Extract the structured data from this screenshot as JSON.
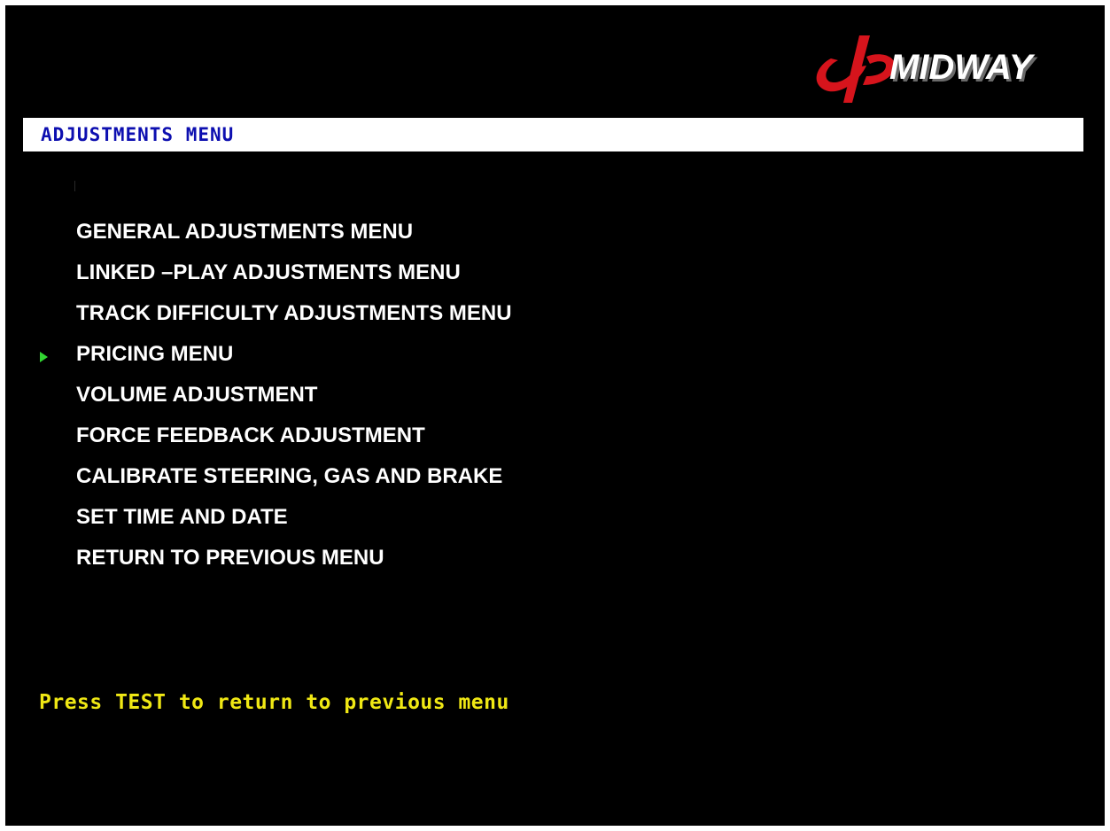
{
  "logo": {
    "text": "MIDWAY",
    "colors": {
      "emblem": "#d6141c",
      "wordmark": "#ffffff",
      "shadow": "#6a6a6a"
    }
  },
  "header": {
    "title": "ADJUSTMENTS MENU"
  },
  "menu": {
    "selected_index": 3,
    "items": [
      {
        "label": "GENERAL ADJUSTMENTS MENU"
      },
      {
        "label": "LINKED –PLAY ADJUSTMENTS MENU"
      },
      {
        "label": "TRACK DIFFICULTY ADJUSTMENTS MENU"
      },
      {
        "label": "PRICING MENU"
      },
      {
        "label": "VOLUME ADJUSTMENT"
      },
      {
        "label": "FORCE FEEDBACK ADJUSTMENT"
      },
      {
        "label": "CALIBRATE STEERING, GAS AND BRAKE"
      },
      {
        "label": "SET TIME AND DATE"
      },
      {
        "label": "RETURN TO PREVIOUS MENU"
      }
    ]
  },
  "cursor": {
    "icon": "play-arrow-icon",
    "color": "#32d632"
  },
  "footer": {
    "hint": "Press TEST to return to previous menu"
  },
  "colors": {
    "background": "#000000",
    "frame": "#ffffff",
    "header_bar": "#ffffff",
    "header_text": "#0d0fb0",
    "menu_text": "#ffffff",
    "footer_text": "#f0e814"
  }
}
